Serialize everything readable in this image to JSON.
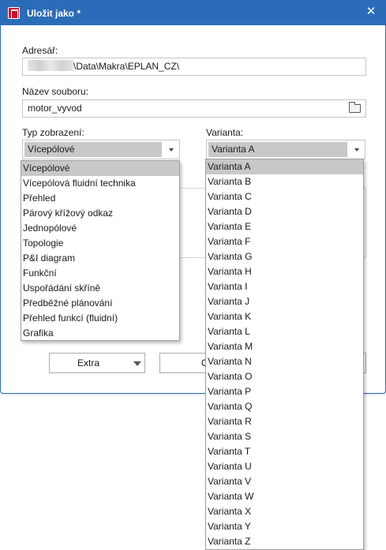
{
  "window": {
    "title": "Uložit jako *",
    "close_glyph": "✕"
  },
  "form": {
    "directory_label": "Adresář:",
    "directory_value": "\\Data\\Makra\\EPLAN_CZ\\",
    "filename_label": "Název souboru:",
    "filename_value": "motor_vyvod",
    "view_type_label": "Typ zobrazení:",
    "view_type_value": "Vícepólové",
    "variant_label": "Varianta:",
    "variant_value": "Varianta A"
  },
  "buttons": {
    "extra_label": "Extra",
    "ok_label_partial": "O"
  },
  "icons": {
    "app": "eplan-app-icon",
    "browse": "folder-open-icon"
  },
  "view_type_options": [
    "Vícepólové",
    "Vícepólová fluidní technika",
    "Přehled",
    "Párový křížový odkaz",
    "Jednopólové",
    "Topologie",
    "P&I diagram",
    "Funkční",
    "Uspořádání skříně",
    "Předběžné plánování",
    "Přehled funkcí (fluidní)",
    "Grafika"
  ],
  "variant_options": [
    "Varianta A",
    "Varianta B",
    "Varianta C",
    "Varianta D",
    "Varianta E",
    "Varianta F",
    "Varianta G",
    "Varianta H",
    "Varianta I",
    "Varianta J",
    "Varianta K",
    "Varianta L",
    "Varianta M",
    "Varianta N",
    "Varianta O",
    "Varianta P",
    "Varianta Q",
    "Varianta R",
    "Varianta S",
    "Varianta T",
    "Varianta U",
    "Varianta V",
    "Varianta W",
    "Varianta X",
    "Varianta Y",
    "Varianta Z"
  ],
  "colors": {
    "titlebar": "#2b6cb8",
    "selection": "#c8c8c8"
  }
}
